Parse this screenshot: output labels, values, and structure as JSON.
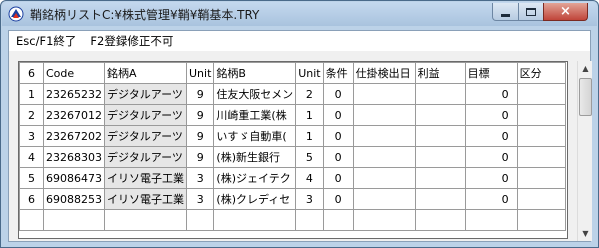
{
  "window": {
    "title": "鞘銘柄リストC:¥株式管理¥鞘¥鞘基本.TRY",
    "controls": {
      "minimize": "0",
      "maximize": "□",
      "close": "×"
    }
  },
  "fkeys": {
    "esc": "Esc/F1終了",
    "f2": "F2登録修正不可"
  },
  "grid": {
    "headers": [
      "6",
      "Code",
      "銘柄A",
      "Unit",
      "銘柄B",
      "Unit",
      "条件",
      "仕掛検出日",
      "利益",
      "目標",
      "区分"
    ],
    "rows": [
      {
        "no": "1",
        "code": "23265232",
        "a": "デジタルアーツ",
        "ua": "9",
        "b": "住友大阪セメン",
        "ub": "2",
        "cond": "0",
        "date": "",
        "profit": "",
        "target": "0",
        "kubun": ""
      },
      {
        "no": "2",
        "code": "23267012",
        "a": "デジタルアーツ",
        "ua": "9",
        "b": "川崎重工業(株",
        "ub": "1",
        "cond": "0",
        "date": "",
        "profit": "",
        "target": "0",
        "kubun": ""
      },
      {
        "no": "3",
        "code": "23267202",
        "a": "デジタルアーツ",
        "ua": "9",
        "b": "いすゞ自動車(",
        "ub": "1",
        "cond": "0",
        "date": "",
        "profit": "",
        "target": "0",
        "kubun": ""
      },
      {
        "no": "4",
        "code": "23268303",
        "a": "デジタルアーツ",
        "ua": "9",
        "b": "(株)新生銀行",
        "ub": "5",
        "cond": "0",
        "date": "",
        "profit": "",
        "target": "0",
        "kubun": ""
      },
      {
        "no": "5",
        "code": "69086473",
        "a": "イリソ電子工業",
        "ua": "3",
        "b": "(株)ジェイテク",
        "ub": "4",
        "cond": "0",
        "date": "",
        "profit": "",
        "target": "0",
        "kubun": ""
      },
      {
        "no": "6",
        "code": "69088253",
        "a": "イリソ電子工業",
        "ua": "3",
        "b": "(株)クレディセ",
        "ub": "3",
        "cond": "0",
        "date": "",
        "profit": "",
        "target": "0",
        "kubun": ""
      }
    ]
  },
  "scrollbar": {
    "up": "▲",
    "down": "▼"
  }
}
